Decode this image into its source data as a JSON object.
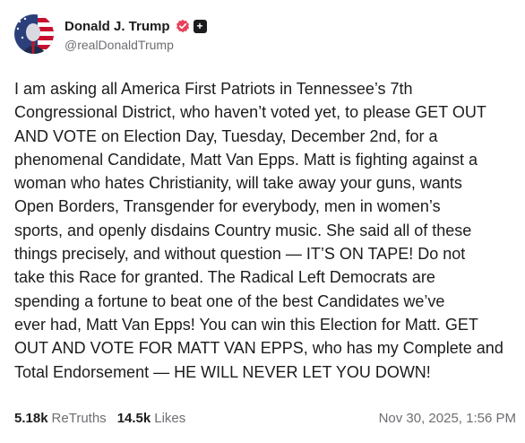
{
  "author": {
    "display_name": "Donald J. Trump",
    "handle": "@realDonaldTrump",
    "avatar_icon": "profile-photo-icon",
    "verified_icon": "verified-badge-icon",
    "verified_color": "#e8415b",
    "extra_badge_icon": "plus-badge-icon",
    "extra_badge_glyph": "+"
  },
  "post": {
    "text": "I am asking all America First Patriots in Tennessee’s 7th\nCongressional District, who haven’t voted yet, to please GET OUT\nAND VOTE on Election Day, Tuesday, December 2nd, for a\nphenomenal Candidate, Matt Van Epps. Matt is fighting against a\nwoman who hates Christianity, will take away your guns, wants\nOpen Borders, Transgender for everybody, men in women’s\nsports, and openly disdains Country music. She said all of these\nthings precisely, and without question — IT’S ON TAPE! Do not\ntake this Race for granted. The Radical Left Democrats are\nspending a fortune to beat one of the best Candidates we’ve\never had, Matt Van Epps! You can win this Election for Matt. GET\nOUT AND VOTE FOR MATT VAN EPPS, who has my Complete and\nTotal Endorsement — HE WILL NEVER LET YOU DOWN!"
  },
  "stats": {
    "retruths_count": "5.18k",
    "retruths_label": "ReTruths",
    "likes_count": "14.5k",
    "likes_label": "Likes"
  },
  "timestamp": "Nov 30, 2025, 1:56 PM"
}
